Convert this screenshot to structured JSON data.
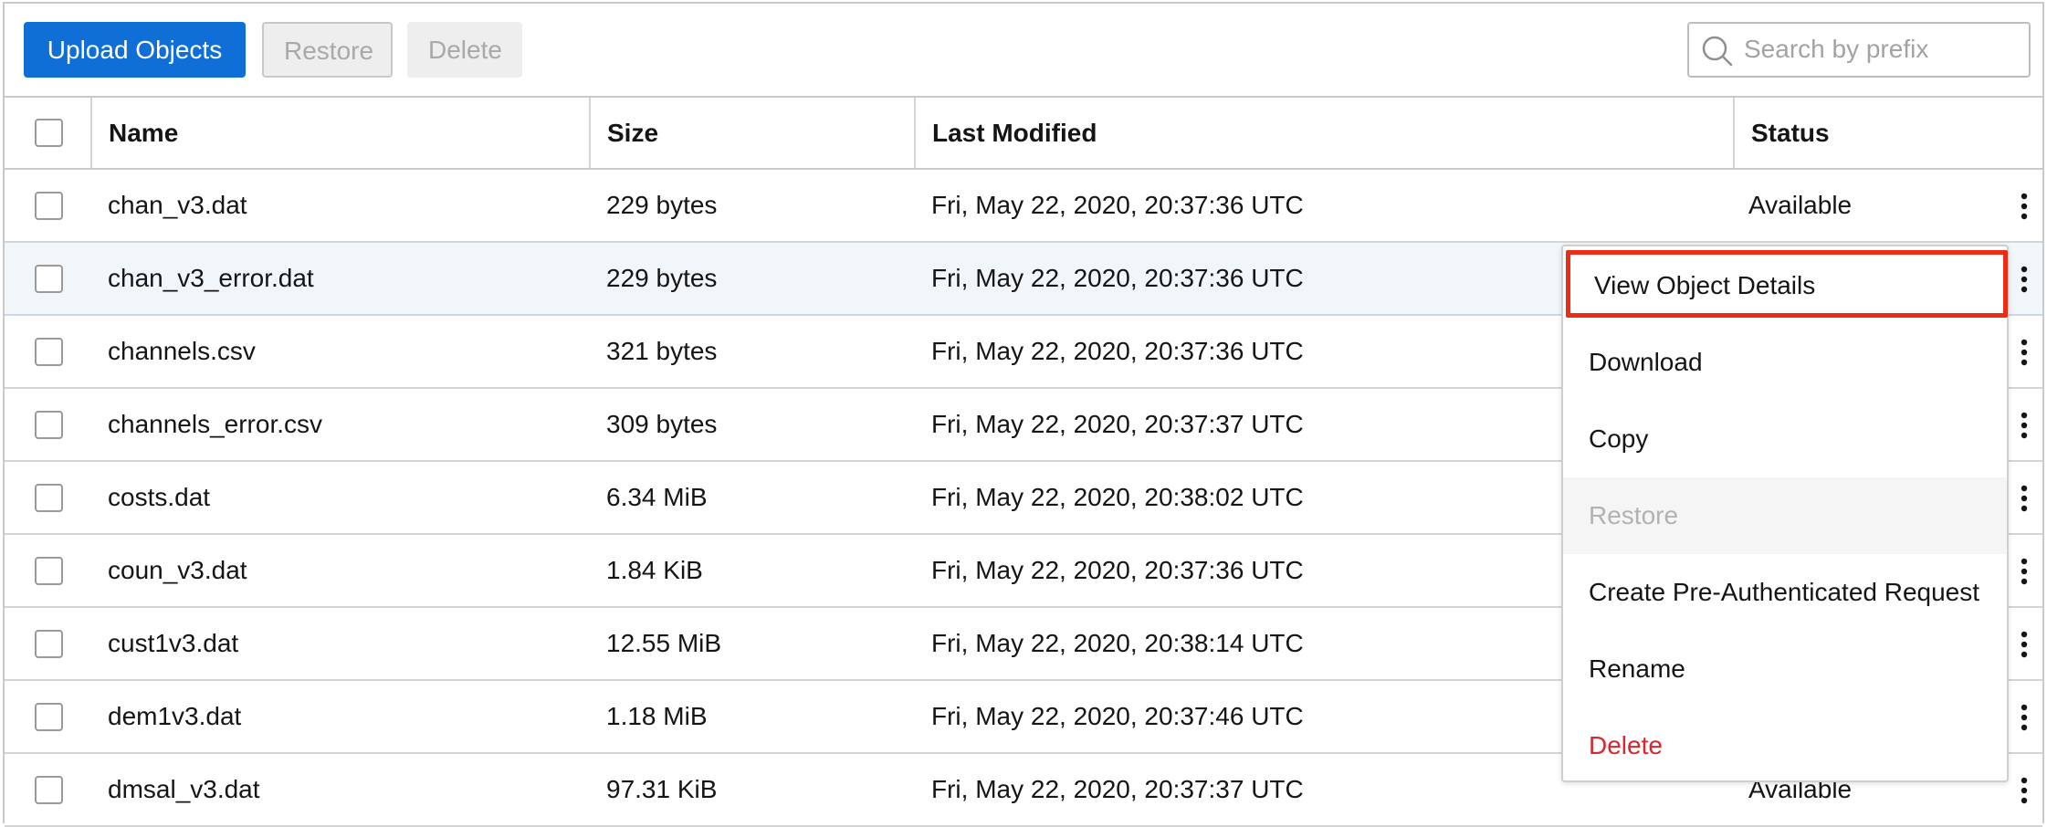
{
  "toolbar": {
    "upload_label": "Upload Objects",
    "restore_label": "Restore",
    "delete_label": "Delete",
    "search_placeholder": "Search by prefix"
  },
  "table": {
    "columns": [
      "Name",
      "Size",
      "Last Modified",
      "Status"
    ],
    "rows": [
      {
        "name": "chan_v3.dat",
        "size": "229 bytes",
        "modified": "Fri, May 22, 2020, 20:37:36 UTC",
        "status": "Available"
      },
      {
        "name": "chan_v3_error.dat",
        "size": "229 bytes",
        "modified": "Fri, May 22, 2020, 20:37:36 UTC",
        "status": ""
      },
      {
        "name": "channels.csv",
        "size": "321 bytes",
        "modified": "Fri, May 22, 2020, 20:37:36 UTC",
        "status": ""
      },
      {
        "name": "channels_error.csv",
        "size": "309 bytes",
        "modified": "Fri, May 22, 2020, 20:37:37 UTC",
        "status": ""
      },
      {
        "name": "costs.dat",
        "size": "6.34 MiB",
        "modified": "Fri, May 22, 2020, 20:38:02 UTC",
        "status": ""
      },
      {
        "name": "coun_v3.dat",
        "size": "1.84 KiB",
        "modified": "Fri, May 22, 2020, 20:37:36 UTC",
        "status": ""
      },
      {
        "name": "cust1v3.dat",
        "size": "12.55 MiB",
        "modified": "Fri, May 22, 2020, 20:38:14 UTC",
        "status": ""
      },
      {
        "name": "dem1v3.dat",
        "size": "1.18 MiB",
        "modified": "Fri, May 22, 2020, 20:37:46 UTC",
        "status": ""
      },
      {
        "name": "dmsal_v3.dat",
        "size": "97.31 KiB",
        "modified": "Fri, May 22, 2020, 20:37:37 UTC",
        "status": "Available"
      }
    ]
  },
  "context_menu": {
    "items": [
      {
        "label": "View Object Details",
        "state": "highlighted"
      },
      {
        "label": "Download",
        "state": "normal"
      },
      {
        "label": "Copy",
        "state": "normal"
      },
      {
        "label": "Restore",
        "state": "disabled"
      },
      {
        "label": "Create Pre-Authenticated Request",
        "state": "normal"
      },
      {
        "label": "Rename",
        "state": "normal"
      },
      {
        "label": "Delete",
        "state": "danger"
      }
    ]
  },
  "icons": {
    "search": "search-icon",
    "row_actions": "kebab-menu-icon"
  },
  "colors": {
    "primary": "#0f6fd6",
    "selected_row": "#f1f6fb",
    "highlight_border": "#ea2d14",
    "danger": "#d8262e"
  }
}
